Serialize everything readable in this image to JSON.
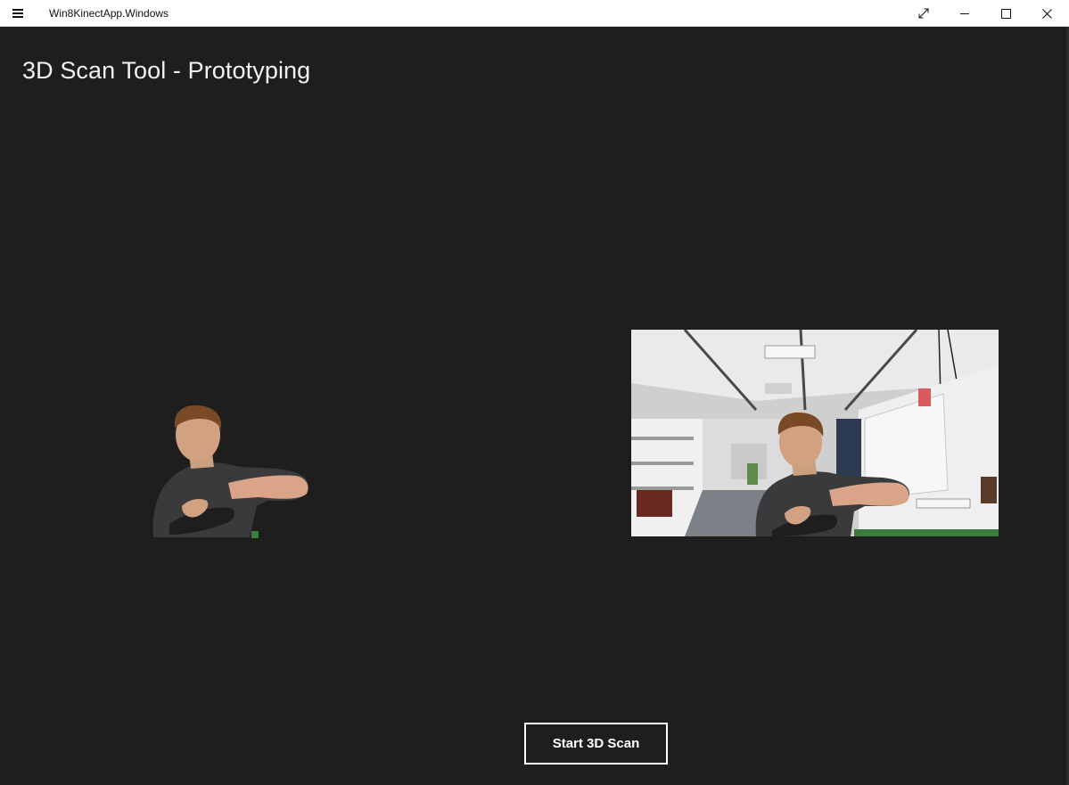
{
  "window": {
    "title": "Win8KinectApp.Windows",
    "controls": {
      "menu_icon": "hamburger-icon",
      "fullscreen_icon": "fullscreen-icon",
      "minimize_icon": "minimize-icon",
      "maximize_icon": "maximize-icon",
      "close_icon": "close-icon"
    }
  },
  "main": {
    "title": "3D Scan Tool - Prototyping"
  },
  "views": {
    "segmented_body_view": "body-segmentation-image",
    "color_camera_view": "color-camera-image"
  },
  "actions": {
    "start_scan_label": "Start 3D Scan"
  },
  "colors": {
    "background": "#1e1e1e",
    "titlebar": "#ffffff",
    "text_light": "#f2f2f2",
    "button_border": "#ffffff"
  }
}
